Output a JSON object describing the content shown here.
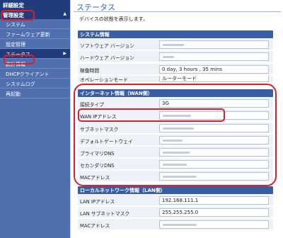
{
  "sidebar": {
    "header": "詳細設定",
    "group_title": "管理設定",
    "items": [
      {
        "label": "システム"
      },
      {
        "label": "ファームウェア更新"
      },
      {
        "label": "設定管理"
      },
      {
        "label": "ステータス"
      },
      {
        "label": "統計情報"
      },
      {
        "label": "DHCPクライアント"
      },
      {
        "label": "システムログ"
      },
      {
        "label": "再起動"
      }
    ],
    "collapse_glyph": "▲",
    "arrow_glyph": "▶"
  },
  "main": {
    "title": "ステータス",
    "description": "デバイスの状態を表示します。"
  },
  "system_info": {
    "title": "システム情報",
    "rows": [
      {
        "label": "ソフトウェア バージョン",
        "value": ""
      },
      {
        "label": "ハードウェア バージョン",
        "value": ""
      },
      {
        "label": "稼働時間",
        "value": "0 day,  3 hours , 35 mins"
      },
      {
        "label": "オペレーションモード",
        "value": "ルーターモード"
      }
    ]
  },
  "internet_info": {
    "title": "インターネット情報（WAN側）",
    "rows": [
      {
        "label": "接続タイプ",
        "value": "3G"
      },
      {
        "label": "WAN IPアドレス",
        "value": ""
      },
      {
        "label": "サブネットマスク",
        "value": ""
      },
      {
        "label": "デフォルトゲートウェイ",
        "value": ""
      },
      {
        "label": "プライマリDNS",
        "value": ""
      },
      {
        "label": "セカンダリDNS",
        "value": ""
      },
      {
        "label": "MACアドレス",
        "value": ""
      }
    ]
  },
  "lan_info": {
    "title": "ローカルネットワーク情報（LAN側）",
    "rows": [
      {
        "label": "LAN IPアドレス",
        "value": "192.168.111.1"
      },
      {
        "label": "LAN サブネットマスク",
        "value": "255.255.255.0"
      },
      {
        "label": "MACアドレス",
        "value": ""
      }
    ]
  },
  "colors": {
    "sidebar_bg": "#4f6fae",
    "sidebar_dark": "#203c7c",
    "section_header": "#3a5ea4",
    "row_bg": "#eef2f8",
    "title_blue": "#3b66b3",
    "highlight_red": "#e11d2a"
  }
}
